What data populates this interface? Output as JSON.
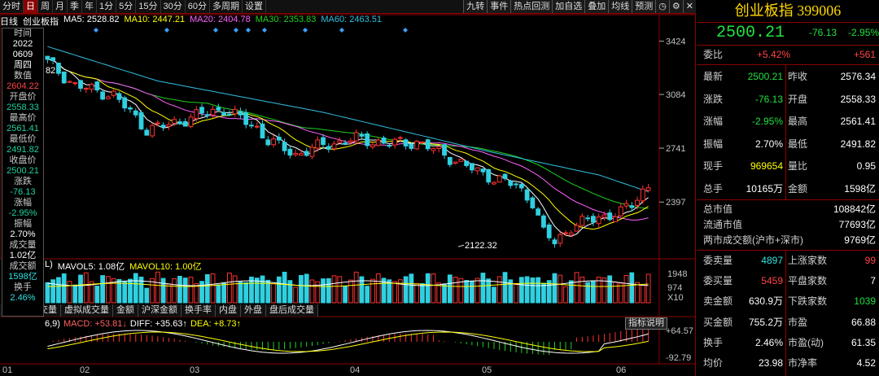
{
  "toolbar": {
    "left": [
      "分时",
      "日",
      "周",
      "月",
      "季",
      "年",
      "1分",
      "5分",
      "15分",
      "30分",
      "60分",
      "多周期",
      "设置"
    ],
    "active": "日",
    "right": [
      "九转",
      "事件",
      "热点回测",
      "加自选",
      "叠加",
      "均线",
      "预测"
    ]
  },
  "ma_line": {
    "prefix": "日线",
    "name": "创业板指",
    "ma5": "MA5: 2528.82",
    "ma10": "MA10: 2447.21",
    "ma20": "MA20: 2404.78",
    "ma30": "MA30: 2353.83",
    "ma60": "MA60: 2463.51"
  },
  "info": {
    "time_label": "时间",
    "year": "2022",
    "date": "0609",
    "weekday": "周四",
    "value_label": "数值",
    "open_label": "开盘价",
    "open": "2604.22",
    "high_label": "最高价",
    "high": "2558.33",
    "high2": "2561.41",
    "low_label": "最低价",
    "low": "2491.82",
    "close_label": "收盘价",
    "close": "2500.21",
    "chg_label": "涨跌",
    "chg": "-76.13",
    "pct_label": "涨幅",
    "pct": "-2.95%",
    "amp_label": "振幅",
    "amp": "2.70%",
    "vol_label": "成交量",
    "vol": "1.02亿",
    "amt_label": "成交额",
    "amt": "1598亿",
    "turn_label": "换手",
    "turn": "2.46%"
  },
  "price_axis": [
    "3424",
    "3084",
    "2741",
    "2397"
  ],
  "price_annot": {
    "low": "2122.32",
    "left": "82"
  },
  "vol_line": {
    "a": "L)",
    "mavol5": "MAVOL5: 1.08亿",
    "mavol10": "MAVOL10: 1.00亿"
  },
  "vol_axis": [
    "1948",
    "974",
    "X10"
  ],
  "tabs2": [
    "多周期成交量",
    "虚拟成交量",
    "金额",
    "沪深金额",
    "换手率",
    "内盘",
    "外盘",
    "盘后成交量"
  ],
  "macd_line": {
    "params": "6,9)",
    "macd": "MACD: +53.81↓",
    "diff": "DIFF: +35.63↑",
    "dea": "DEA: +8.73↑"
  },
  "macd_axis": [
    "+64.57",
    "-92.79"
  ],
  "macd_btn": "指标说明",
  "x_axis": [
    "01",
    "02",
    "03",
    "04",
    "05",
    "06"
  ],
  "quote": {
    "title": "创业板指 399006",
    "price": "2500.21",
    "change": "-76.13",
    "pct": "-2.95%",
    "weibi_label": "委比",
    "weibi": "+5.42%",
    "weicha": "+561",
    "rows": [
      {
        "l1": "最新",
        "v1": "2500.21",
        "l2": "昨收",
        "v2": "2576.34"
      },
      {
        "l1": "涨跌",
        "v1": "-76.13",
        "l2": "开盘",
        "v2": "2558.33"
      },
      {
        "l1": "涨幅",
        "v1": "-2.95%",
        "l2": "最高",
        "v2": "2561.41"
      },
      {
        "l1": "振幅",
        "v1": "2.70%",
        "l2": "最低",
        "v2": "2491.82"
      },
      {
        "l1": "现手",
        "v1": "969654",
        "l2": "量比",
        "v2": "0.95"
      },
      {
        "l1": "总手",
        "v1": "10165万",
        "l2": "金额",
        "v2": "1598亿"
      }
    ],
    "zsz_label": "总市值",
    "zsz": "108842亿",
    "ltsz_label": "流通市值",
    "ltsz": "77693亿",
    "lscj_label": "两市成交额(沪市+深市)",
    "lscj": "9769亿",
    "rows2": [
      {
        "l1": "委卖量",
        "v1": "4897",
        "l2": "上涨家数",
        "v2": "99"
      },
      {
        "l1": "委买量",
        "v1": "5459",
        "l2": "平盘家数",
        "v2": "7"
      },
      {
        "l1": "卖金额",
        "v1": "630.9万",
        "l2": "下跌家数",
        "v2": "1039"
      },
      {
        "l1": "买金额",
        "v1": "755.2万",
        "l2": "市盈",
        "v2": "66.88"
      },
      {
        "l1": "换手",
        "v1": "2.46%",
        "l2": "市盈(动)",
        "v2": "61.35"
      },
      {
        "l1": "均价",
        "v1": "23.98",
        "l2": "市净率",
        "v2": "4.52"
      }
    ]
  },
  "colors": {
    "up": "#ff3030",
    "down": "#30d0e0",
    "ma5": "#ffffff",
    "ma10": "#ffff00",
    "ma20": "#ff60ff",
    "ma30": "#20d020",
    "ma60": "#30c0e0"
  },
  "chart_data": {
    "type": "candlestick",
    "price_range": [
      2050,
      3500
    ],
    "ticks": [
      3424,
      3084,
      2741,
      2397
    ],
    "low_annotation": 2122.32,
    "series": [
      {
        "name": "MA5",
        "last": 2528.82
      },
      {
        "name": "MA10",
        "last": 2447.21
      },
      {
        "name": "MA20",
        "last": 2404.78
      },
      {
        "name": "MA30",
        "last": 2353.83
      },
      {
        "name": "MA60",
        "last": 2463.51
      }
    ],
    "volume_range": [
      0,
      1948
    ],
    "macd": {
      "MACD": 53.81,
      "DIFF": 35.63,
      "DEA": 8.73,
      "range": [
        -92.79,
        64.57
      ]
    }
  }
}
